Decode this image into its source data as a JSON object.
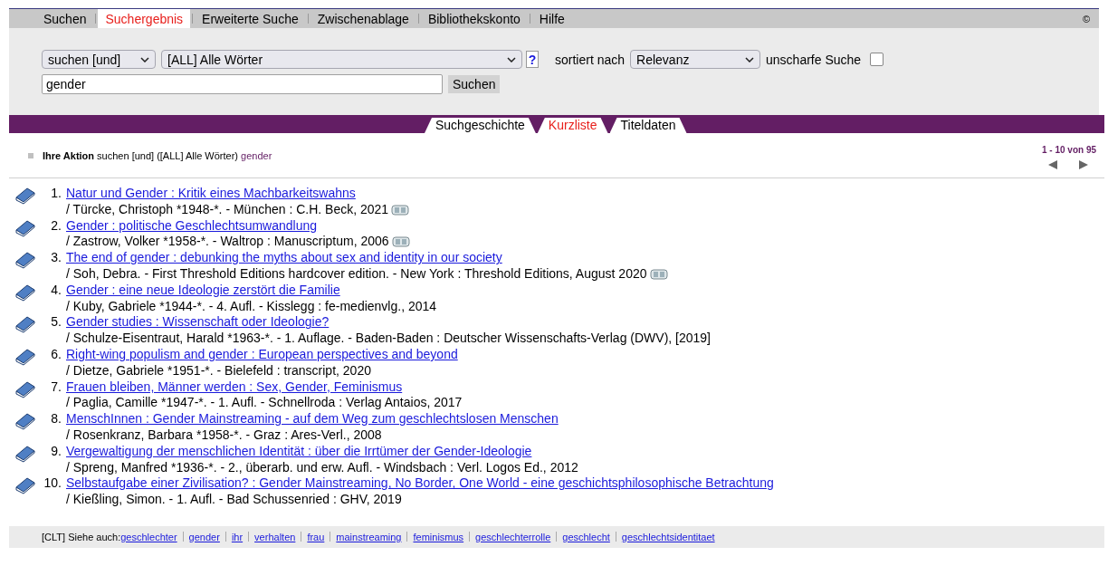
{
  "menu": [
    {
      "label": "Suchen",
      "selected": false
    },
    {
      "label": "Suchergebnis",
      "selected": true
    },
    {
      "label": "Erweiterte Suche",
      "selected": false
    },
    {
      "label": "Zwischenablage",
      "selected": false
    },
    {
      "label": "Bibliothekskonto",
      "selected": false
    },
    {
      "label": "Hilfe",
      "selected": false
    }
  ],
  "copyright": "©",
  "search": {
    "mode": "suchen [und]",
    "index": "[ALL] Alle Wörter",
    "help": "?",
    "sort_label": "sortiert nach",
    "sort": "Relevanz",
    "fuzzy_label": "unscharfe Suche",
    "fuzzy_checked": false,
    "query": "gender",
    "submit": "Suchen"
  },
  "view_tabs": [
    {
      "label": "Suchgeschichte",
      "selected": false
    },
    {
      "label": "Kurzliste",
      "selected": true
    },
    {
      "label": "Titeldaten",
      "selected": false
    }
  ],
  "action": {
    "label": "Ihre Aktion",
    "text": "suchen [und] ([ALL] Alle Wörter)",
    "term": "gender"
  },
  "paging": {
    "range": "1 - 10 von 95"
  },
  "results": [
    {
      "number": "1.",
      "title": "Natur und Gender : Kritik eines Machbarkeitswahns",
      "details": "/ Türcke, Christoph *1948-*. - München : C.H. Beck, 2021",
      "toc": true
    },
    {
      "number": "2.",
      "title": "Gender : politische Geschlechtsumwandlung",
      "details": "/ Zastrow, Volker *1958-*. - Waltrop : Manuscriptum, 2006",
      "toc": true
    },
    {
      "number": "3.",
      "title": "The end of gender : debunking the myths about sex and identity in our society",
      "details": "/ Soh, Debra. - First Threshold Editions hardcover edition. - New York : Threshold Editions, August 2020",
      "toc": true
    },
    {
      "number": "4.",
      "title": "Gender : eine neue Ideologie zerstört die Familie",
      "details": "/ Kuby, Gabriele *1944-*. - 4. Aufl. - Kisslegg : fe-medienvlg., 2014",
      "toc": false
    },
    {
      "number": "5.",
      "title": "Gender studies : Wissenschaft oder Ideologie?",
      "details": "/ Schulze-Eisentraut, Harald *1963-*. - 1. Auflage. - Baden-Baden : Deutscher Wissenschafts-Verlag (DWV), [2019]",
      "toc": false
    },
    {
      "number": "6.",
      "title": "Right-wing populism and gender : European perspectives and beyond",
      "details": "/ Dietze, Gabriele *1951-*. - Bielefeld : transcript, 2020",
      "toc": false
    },
    {
      "number": "7.",
      "title": "Frauen bleiben, Männer werden : Sex, Gender, Feminismus",
      "details": "/ Paglia, Camille *1947-*. - 1. Aufl. - Schnellroda : Verlag Antaios, 2017",
      "toc": false
    },
    {
      "number": "8.",
      "title": "MenschInnen : Gender Mainstreaming - auf dem Weg zum geschlechtslosen Menschen",
      "details": "/ Rosenkranz, Barbara *1958-*. - Graz : Ares-Verl., 2008",
      "toc": false
    },
    {
      "number": "9.",
      "title": "Vergewaltigung der menschlichen Identität : über die Irrtümer der Gender-Ideologie",
      "details": "/ Spreng, Manfred *1936-*. - 2., überarb. und erw. Aufl. - Windsbach : Verl. Logos Ed., 2012",
      "toc": false
    },
    {
      "number": "10.",
      "title": "Selbstaufgabe einer Zivilisation? : Gender Mainstreaming, No Border, One World - eine geschichtsphilosophische Betrachtung",
      "details": "/ Kießling, Simon. - 1. Aufl. - Bad Schussenried : GHV, 2019",
      "toc": false
    }
  ],
  "see_also": {
    "label": "[CLT] Siehe auch:",
    "links": [
      "geschlechter",
      "gender",
      "ihr",
      "verhalten",
      "frau",
      "mainstreaming",
      "feminismus",
      "geschlechterrolle",
      "geschlecht",
      "geschlechtsidentitaet"
    ]
  }
}
